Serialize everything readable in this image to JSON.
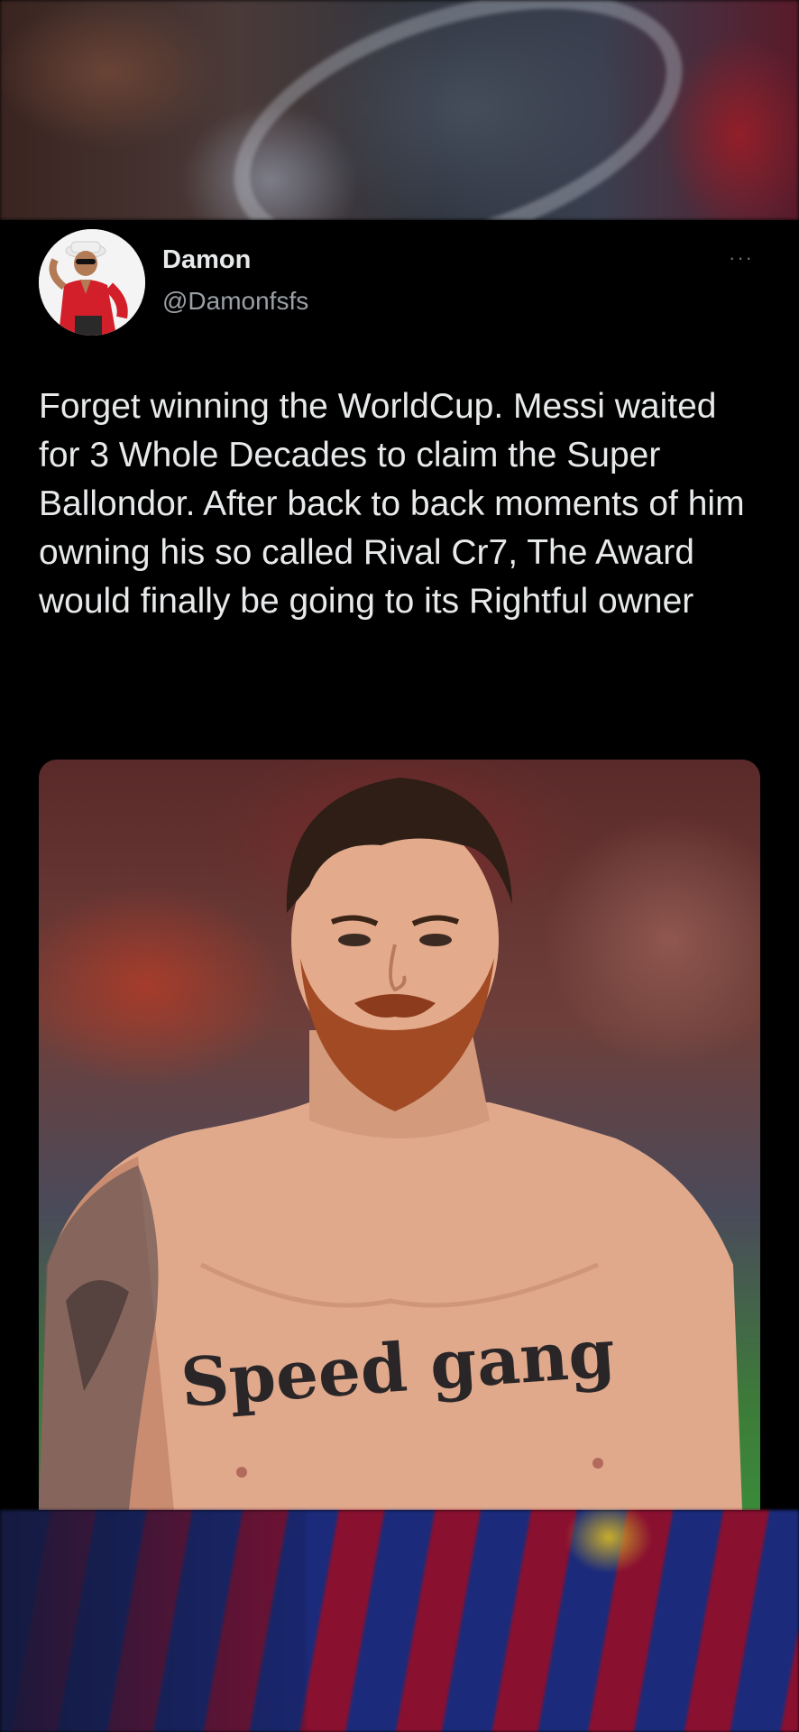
{
  "tweet": {
    "author": {
      "display_name": "Damon",
      "handle": "@Damonfsfs",
      "avatar_icon": "avatar-photo"
    },
    "more_icon": "ellipsis-icon",
    "more_label": "···",
    "text": "Forget winning the WorldCup. Messi waited for 3 Whole Decades to claim the Super Ballondor. After back to back moments of him owning his so called Rival Cr7, The Award would finally be going to its Rightful owner",
    "media": {
      "type": "photo",
      "tattoo_text": "Speed gang"
    }
  },
  "colors": {
    "background": "#000000",
    "text_primary": "#e7e9ea",
    "text_secondary": "#9aa0a6"
  }
}
